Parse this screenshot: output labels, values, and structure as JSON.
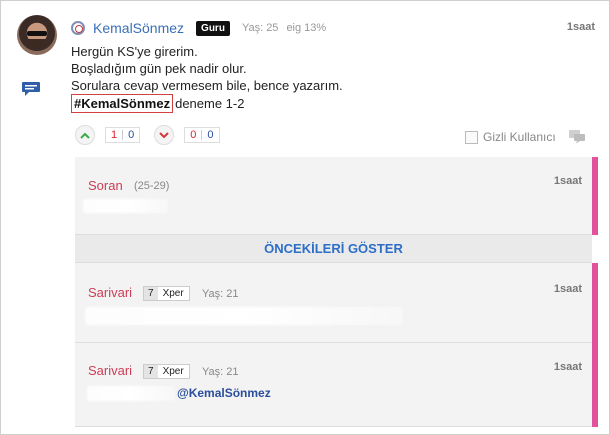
{
  "post": {
    "username": "KemalSönmez",
    "badge": "Guru",
    "age": "Yaş: 25",
    "eig": "eig 13%",
    "time": "1saat",
    "lines": [
      "Hergün KS'ye girerim.",
      "Boşladığım gün pek nadir olur.",
      "Sorulara cevap vermesem bile, bence yazarım."
    ],
    "hashtag": "#KemalSönmez",
    "hashtag_suffix": "deneme 1-2"
  },
  "votes": {
    "up_left": "1",
    "up_right": "0",
    "down_left": "0",
    "down_right": "0"
  },
  "anonymous_label": "Gizli Kullanıcı",
  "comments": {
    "first": {
      "user": "Soran",
      "age": "(25-29)",
      "time": "1saat"
    },
    "show_more": "ÖNCEKİLERİ GÖSTER",
    "second": {
      "user": "Sarivari",
      "level": "7",
      "xper": "Xper",
      "age": "Yaş: 21",
      "time": "1saat"
    },
    "third": {
      "user": "Sarivari",
      "level": "7",
      "xper": "Xper",
      "age": "Yaş: 21",
      "time": "1saat",
      "mention": "@KemalSönmez"
    }
  },
  "colors": {
    "accent_pink": "#e0539a",
    "link_blue": "#3a6fb8",
    "comment_user": "#cc3d56"
  }
}
